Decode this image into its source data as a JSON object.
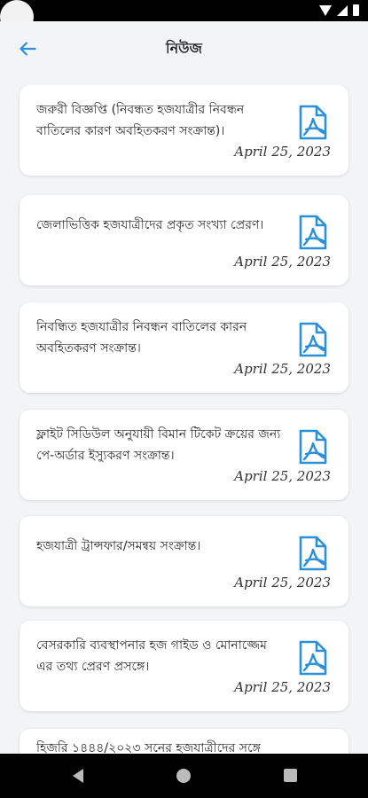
{
  "status": {
    "left_text": ""
  },
  "header": {
    "title": "নিউজ"
  },
  "news": [
    {
      "title": "জরুরী বিজ্ঞপ্তি (নিবন্ধত হজযাত্রীর নিবন্ধন বাতিলের কারণ অবহিতকরণ সংক্রান্ত)।",
      "date": "April 25, 2023"
    },
    {
      "title": "জেলাভিত্তিক হজযাত্রীদের প্রকৃত সংখ্যা প্রেরণ।",
      "date": "April 25, 2023"
    },
    {
      "title": "নিবন্ধিত হজযাত্রীর নিবন্ধন বাতিলের কারন অবহিতকরণ সংক্রান্ত।",
      "date": "April 25, 2023"
    },
    {
      "title": "ফ্লাইট সিডিউল অনুযায়ী বিমান টিকেট ক্রয়ের জন্য পে-অর্ডার ইস্যুকরণ সংক্রান্ত।",
      "date": "April 25, 2023"
    },
    {
      "title": "হজযাত্রী ট্রান্সফার/সমন্বয় সংক্রান্ত।",
      "date": "April 25, 2023"
    },
    {
      "title": "বেসরকারি ব্যবস্থাপনার হজ গাইড ও মোনাজ্জেম এর তথ্য প্রেরণ প্রসঙ্গে।",
      "date": "April 25, 2023"
    },
    {
      "title": "হিজরি ১৪৪৪/২০২৩ সনের হজযাত্রীদের সঙ্গে",
      "date": ""
    }
  ],
  "colors": {
    "accent": "#2d8fd8",
    "card_bg": "#ffffff",
    "page_bg": "#f2f4f6"
  }
}
